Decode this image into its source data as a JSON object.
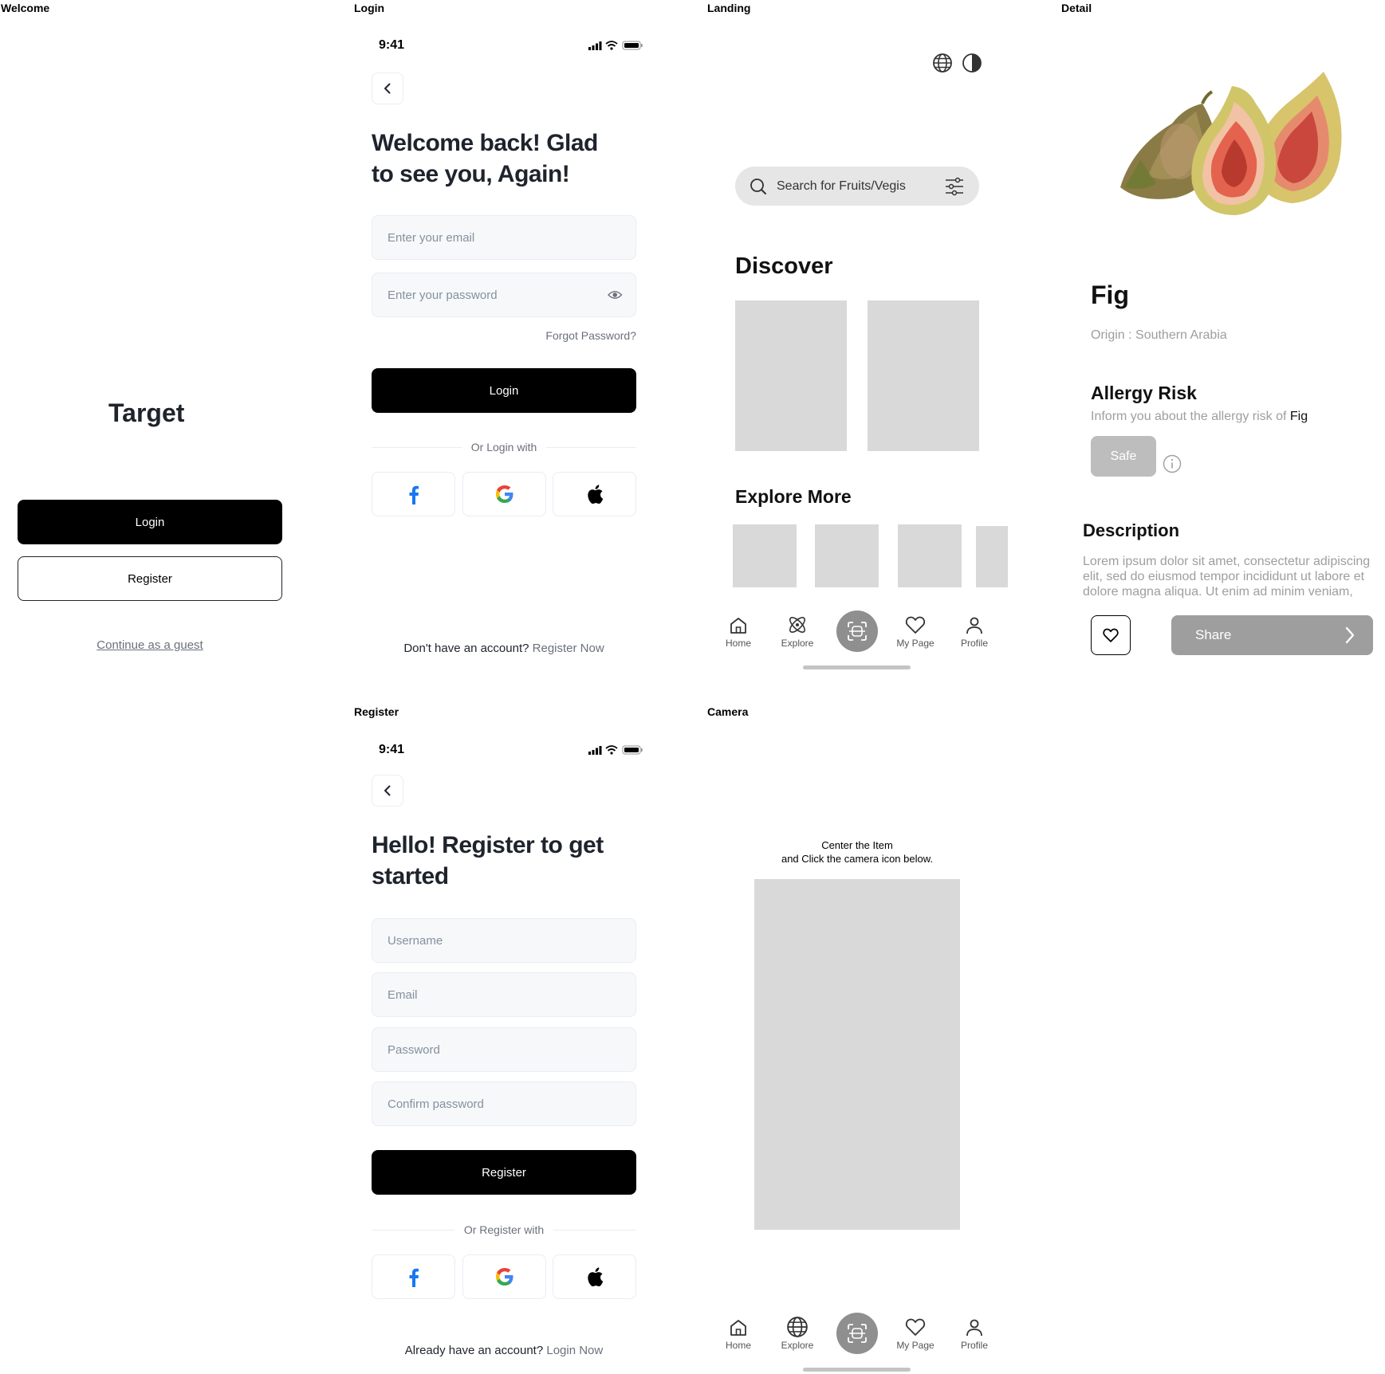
{
  "frames": {
    "welcome": "Welcome",
    "login": "Login",
    "landing": "Landing",
    "detail": "Detail",
    "register": "Register",
    "camera": "Camera"
  },
  "welcome": {
    "app_name": "Target",
    "login_label": "Login",
    "register_label": "Register",
    "guest_label": "Continue as a guest"
  },
  "status_bar": {
    "time": "9:41"
  },
  "login": {
    "heading_line1": "Welcome back! Glad",
    "heading_line2": "to see you, Again!",
    "email_placeholder": "Enter your email",
    "password_placeholder": "Enter your password",
    "forgot_label": "Forgot Password?",
    "login_label": "Login",
    "divider_label": "Or Login with",
    "footer_text": "Don't have an account?",
    "footer_link": "Register Now"
  },
  "landing": {
    "search_placeholder": "Search for Fruits/Vegis",
    "discover_title": "Discover",
    "explore_more_title": "Explore More"
  },
  "bottom_nav": {
    "home": "Home",
    "explore": "Explore",
    "my_page": "My Page",
    "profile": "Profile"
  },
  "detail": {
    "name": "Fig",
    "origin": "Origin : Southern Arabia",
    "allergy_title": "Allergy Risk",
    "allergy_text": "Inform you about the allergy risk of",
    "allergy_item": "Fig",
    "risk_badge": "Safe",
    "description_title": "Description",
    "description_text": "Lorem ipsum dolor sit amet, consectetur adipiscing elit, sed do eiusmod tempor incididunt ut labore et dolore magna aliqua. Ut enim ad minim veniam,",
    "share_label": "Share"
  },
  "register": {
    "heading_line1": "Hello! Register to get",
    "heading_line2": "started",
    "username_placeholder": "Username",
    "email_placeholder": "Email",
    "password_placeholder": "Password",
    "confirm_placeholder": "Confirm password",
    "register_label": "Register",
    "divider_label": "Or Register with",
    "footer_text": "Already have an account?",
    "footer_link": "Login Now"
  },
  "camera": {
    "instruction_line1": "Center the Item",
    "instruction_line2": "and Click the camera icon below."
  },
  "colors": {
    "black": "#000000",
    "field_bg": "#f7f8f9",
    "field_border": "#e8ecf4",
    "placeholder_grey": "#d9d9d9",
    "accent_grey": "#8f8f8f",
    "facebook": "#1877f2"
  }
}
